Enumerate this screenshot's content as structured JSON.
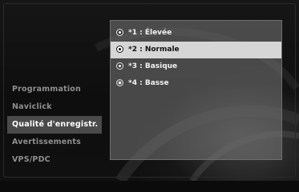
{
  "left_menu": {
    "items": [
      {
        "label": "Programmation",
        "active": false
      },
      {
        "label": "Naviclick",
        "active": false
      },
      {
        "label": "Qualité d'enregistr.",
        "active": true
      },
      {
        "label": "Avertissements",
        "active": false
      },
      {
        "label": "VPS/PDC",
        "active": false
      }
    ]
  },
  "options_panel": {
    "options": [
      {
        "label": "*1 : Élevée",
        "selected": false
      },
      {
        "label": "*2 : Normale",
        "selected": true
      },
      {
        "label": "*3 : Basique",
        "selected": false
      },
      {
        "label": "*4 : Basse",
        "selected": false
      }
    ]
  },
  "colors": {
    "active_menu_bg": "#4a4a4a",
    "selected_option_bg": "#d6d6d6",
    "panel_bg": "#787878"
  }
}
